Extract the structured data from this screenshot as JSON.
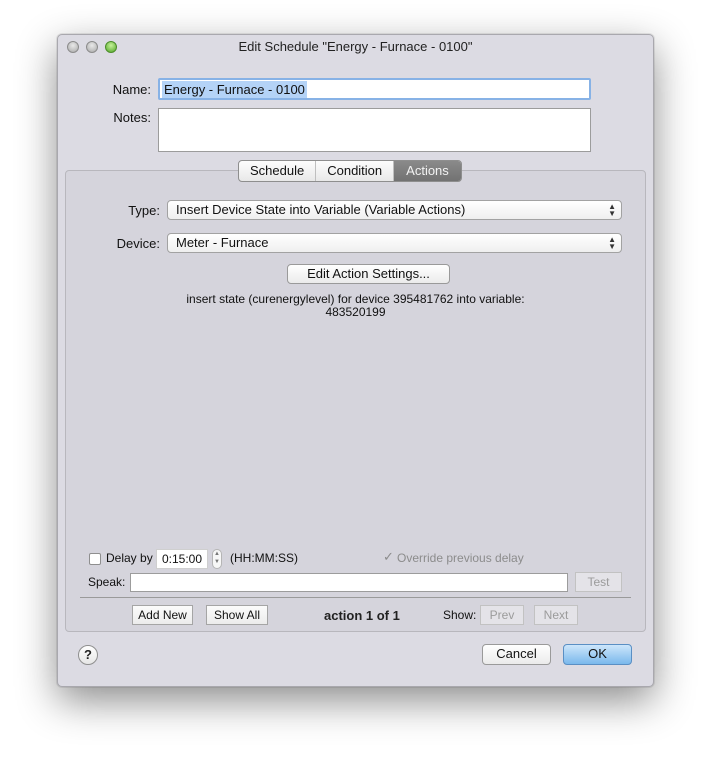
{
  "window": {
    "title": "Edit Schedule \"Energy - Furnace - 0100\"",
    "controls": [
      "close",
      "minimize",
      "zoom"
    ]
  },
  "form": {
    "name_label": "Name:",
    "name_value": "Energy - Furnace - 0100",
    "notes_label": "Notes:",
    "notes_value": ""
  },
  "tabs": [
    {
      "label": "Schedule",
      "active": false
    },
    {
      "label": "Condition",
      "active": false
    },
    {
      "label": "Actions",
      "active": true
    }
  ],
  "actions": {
    "type_label": "Type:",
    "type_value": "Insert Device State into Variable (Variable Actions)",
    "device_label": "Device:",
    "device_value": "Meter - Furnace",
    "edit_settings_label": "Edit Action Settings...",
    "description_line1": "insert state (curenergylevel) for device 395481762 into variable:",
    "description_line2": "483520199",
    "delay_label": "Delay by",
    "delay_checked": false,
    "delay_value": "0:15:00",
    "delay_format": "(HH:MM:SS)",
    "override_label": "Override previous delay",
    "override_checked": true,
    "speak_label": "Speak:",
    "speak_value": "",
    "test_label": "Test",
    "add_new_label": "Add New",
    "show_all_label": "Show All",
    "counter": "action 1 of 1",
    "show_label": "Show:",
    "prev_label": "Prev",
    "next_label": "Next"
  },
  "footer": {
    "help_label": "?",
    "cancel_label": "Cancel",
    "ok_label": "OK"
  },
  "colors": {
    "window_bg": "#dcdbe3",
    "active_tab": "#7d7d7d",
    "ok_button": "#7ab8ec",
    "selection": "#b4d3f7"
  }
}
